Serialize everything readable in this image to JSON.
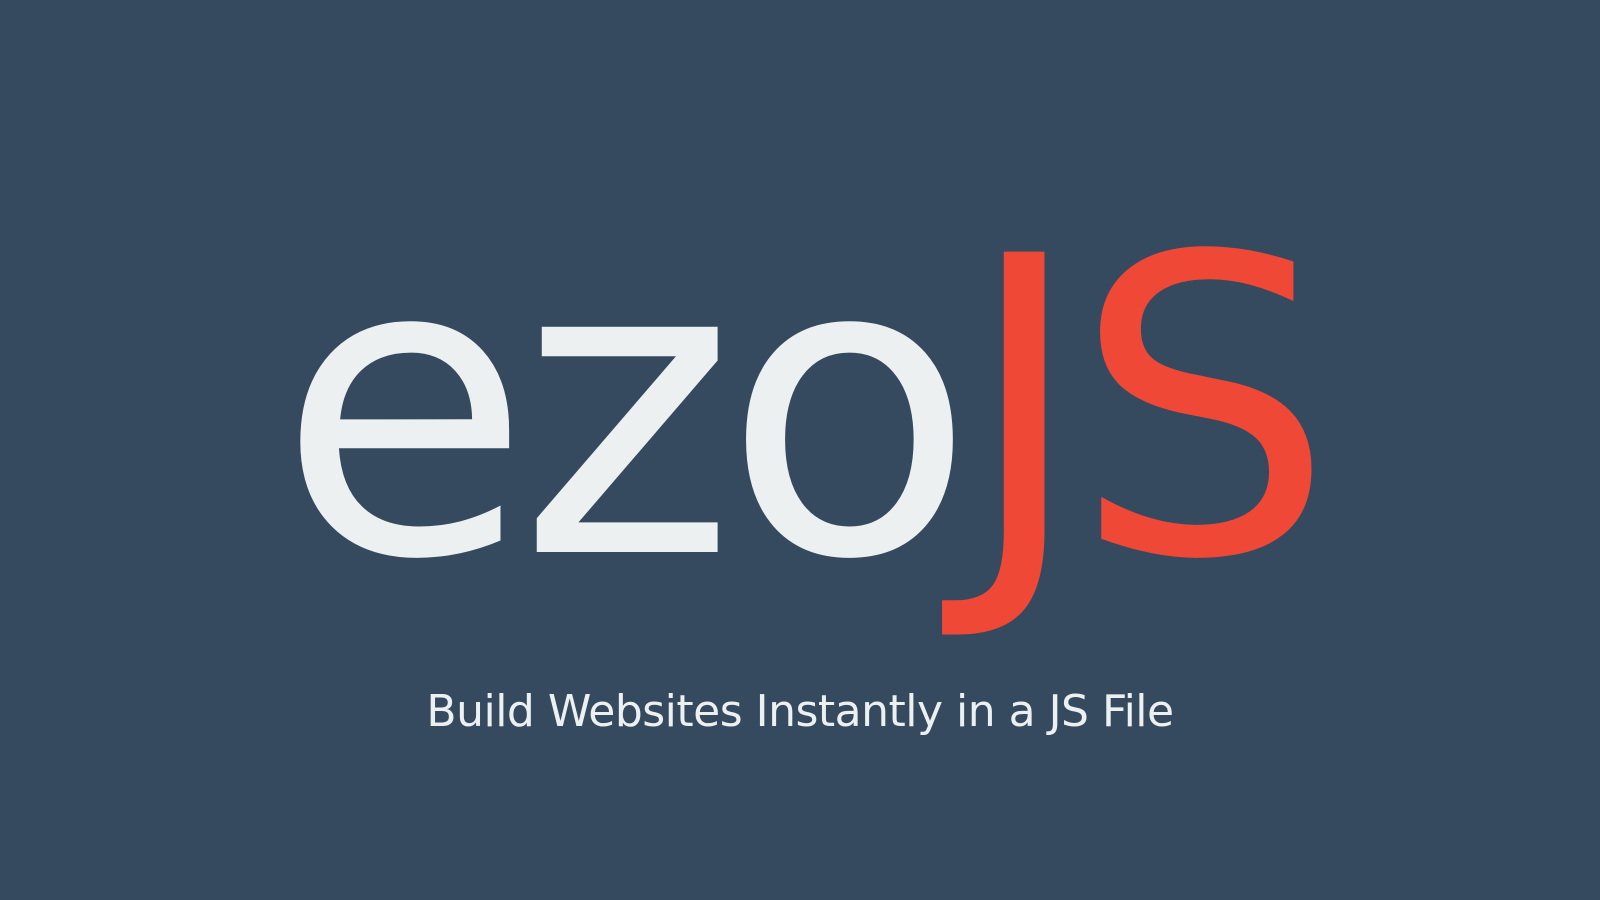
{
  "logo": {
    "primary": "ezo",
    "accent": "JS"
  },
  "tagline": "Build Websites Instantly in a JS File",
  "colors": {
    "background": "#354a5f",
    "primary_text": "#ecf0f1",
    "accent": "#ef4836"
  }
}
